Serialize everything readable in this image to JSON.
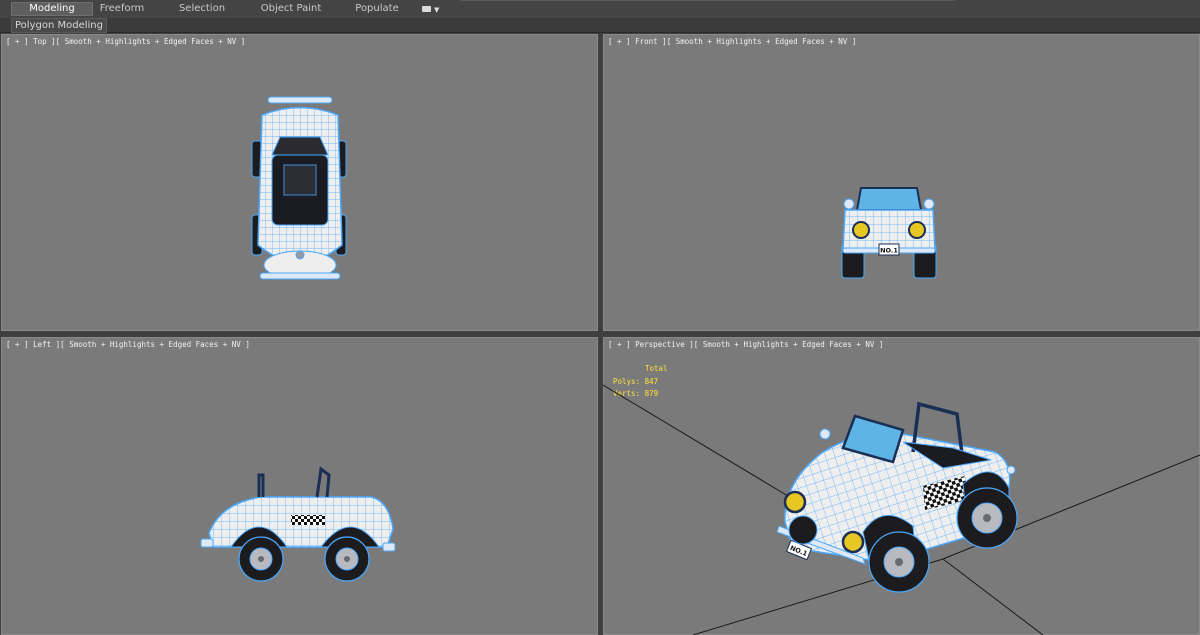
{
  "ribbon": {
    "tabs": [
      {
        "label": "Modeling",
        "active": true
      },
      {
        "label": "Freeform",
        "active": false
      },
      {
        "label": "Selection",
        "active": false
      },
      {
        "label": "Object Paint",
        "active": false
      },
      {
        "label": "Populate",
        "active": false
      }
    ],
    "panel_title": "Polygon Modeling"
  },
  "viewports": {
    "top": {
      "label": "[ + ] Top ][ Smooth + Highlights + Edged Faces + NV ]"
    },
    "front": {
      "label": "[ + ] Front ][ Smooth + Highlights + Edged Faces + NV ]"
    },
    "left": {
      "label": "[ + ] Left ][ Smooth + Highlights + Edged Faces + NV ]"
    },
    "perspective": {
      "label": "[ + ] Perspective ][ Smooth + Highlights + Edged Faces + NV ]"
    }
  },
  "stats": {
    "header": "Total",
    "polys_label": "Polys:",
    "polys_value": "847",
    "verts_label": "Verts:",
    "verts_value": "879"
  },
  "plate_text": "NO.1",
  "colors": {
    "viewport_bg": "#7a7a7a",
    "stats_text": "#ffe23a",
    "wire": "#4aa8ff",
    "car_body": "#f2f2f2",
    "tire": "#1c1c1f",
    "headlight": "#e8c623"
  }
}
